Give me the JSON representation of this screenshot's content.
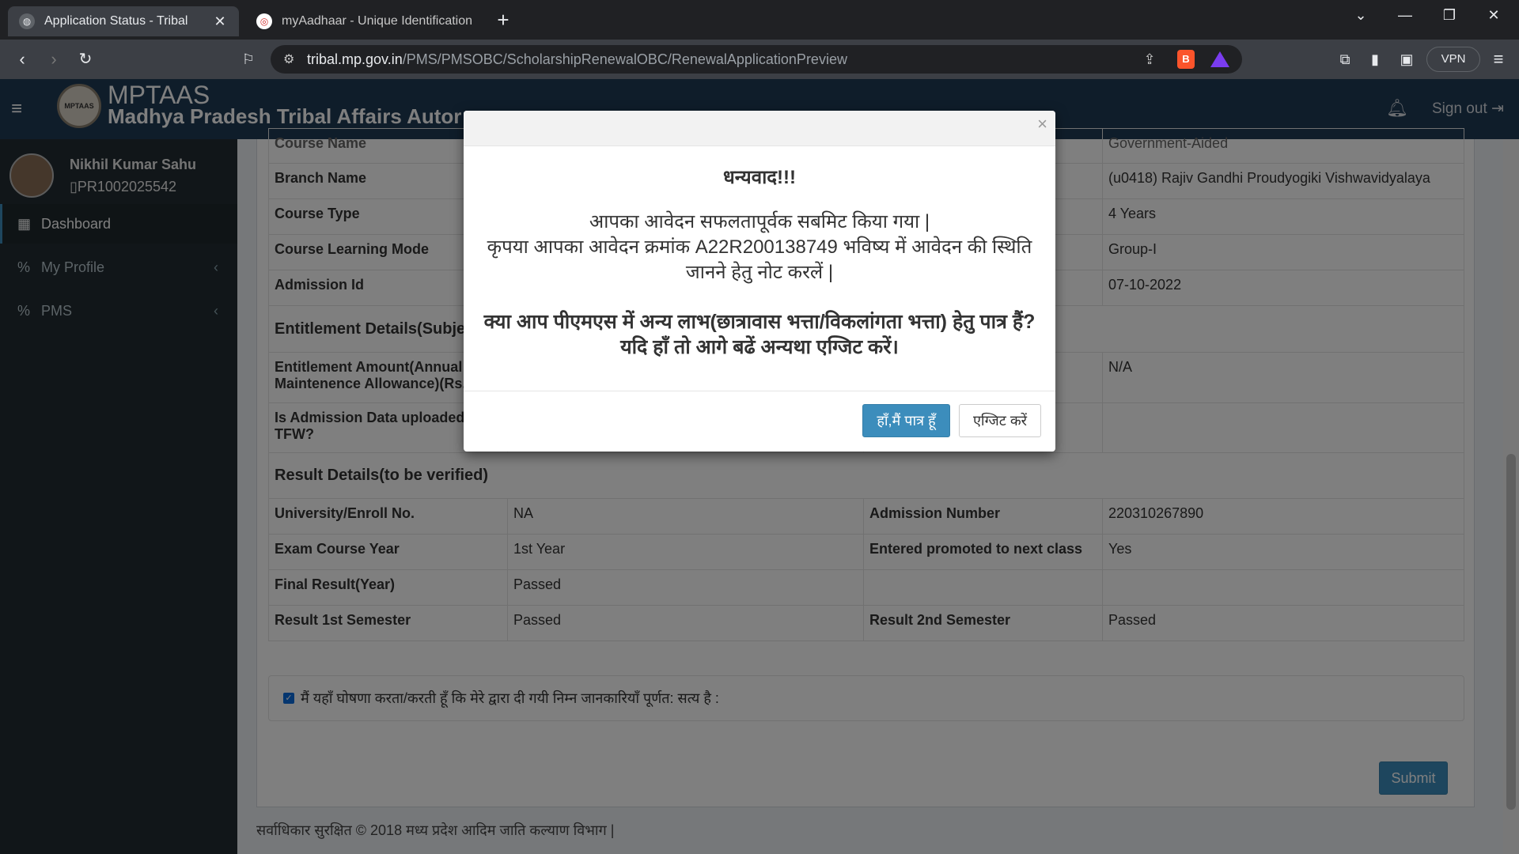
{
  "browser": {
    "tabs": [
      {
        "title": "Application Status - Tribal",
        "icon": "globe-icon"
      },
      {
        "title": "myAadhaar - Unique Identification A",
        "icon": "aadhaar-icon"
      }
    ],
    "url_host": "tribal.mp.gov.in",
    "url_path": "/PMS/PMSOBC/ScholarshipRenewalOBC/RenewalApplicationPreview",
    "vpn_label": "VPN"
  },
  "header": {
    "brand_short": "MPTAAS",
    "brand_long": "Madhya Pradesh Tribal Affairs Autor",
    "logo_text": "MPTAAS",
    "signout": "Sign out"
  },
  "sidebar": {
    "user_name": "Nikhil Kumar Sahu",
    "user_id": "PR1002025542",
    "items": [
      {
        "label": "Dashboard"
      },
      {
        "label": "My Profile"
      },
      {
        "label": "PMS"
      }
    ]
  },
  "details": {
    "rows": [
      {
        "label": "Course Name",
        "right_value": "Government-Aided"
      },
      {
        "label": "Branch Name",
        "right_value": "(u0418) Rajiv Gandhi Proudyogiki Vishwavidyalaya"
      },
      {
        "label": "Course Type",
        "right_value": "4 Years"
      },
      {
        "label": "Course Learning Mode",
        "right_value": "Group-I"
      },
      {
        "label": "Admission Id",
        "right_value": "07-10-2022"
      }
    ],
    "entitlement_title": "Entitlement Details(Subje",
    "entitlement_rows": [
      {
        "label": "Entitlement Amount(Annual F\nMaintenence Allowance)(Rs.)",
        "right_value": "N/A"
      },
      {
        "label": "Is Admission Data uploaded\nTFW?",
        "right_value": ""
      }
    ],
    "result_title": "Result Details(to be verified)",
    "result_rows": [
      {
        "l1": "University/Enroll No.",
        "v1": "NA",
        "l2": "Admission Number",
        "v2": "220310267890"
      },
      {
        "l1": "Exam Course Year",
        "v1": "1st Year",
        "l2": "Entered promoted to next class",
        "v2": "Yes"
      },
      {
        "l1": "Final Result(Year)",
        "v1": "Passed",
        "l2": "",
        "v2": ""
      },
      {
        "l1": "Result 1st Semester",
        "v1": "Passed",
        "l2": "Result 2nd Semester",
        "v2": "Passed"
      }
    ],
    "declaration": "मैं यहाँ घोषणा करता/करती हूँ कि मेरे द्वारा दी गयी निम्न जानकारियाँ पूर्णत: सत्य है :",
    "submit": "Submit",
    "footer": "सर्वाधिकार सुरक्षित © 2018 मध्य प्रदेश आदिम जाति कल्याण विभाग |"
  },
  "modal": {
    "close": "×",
    "thanks": "धन्यवाद!!!",
    "msg_line1": "आपका आवेदन सफलतापूर्वक सबमिट किया गया |",
    "msg_line2": "कृपया आपका आवेदन क्रमांक A22R200138749 भविष्य में आवेदन की स्थिति जानने हेतु नोट करलें |",
    "question_line1": "क्या आप पीएमएस में अन्य लाभ(छात्रावास भत्ता/विकलांगता भत्ता) हेतु पात्र हैं?",
    "question_line2": "यदि हाँ तो आगे बढें अन्यथा एग्जिट करें।",
    "yes_button": "हाँ,मैं पात्र हूँ",
    "exit_button": "एग्जिट करें"
  },
  "colors": {
    "header_bg": "#1f3a55",
    "sidebar_bg": "#222d32",
    "primary": "#3c8dbc"
  }
}
